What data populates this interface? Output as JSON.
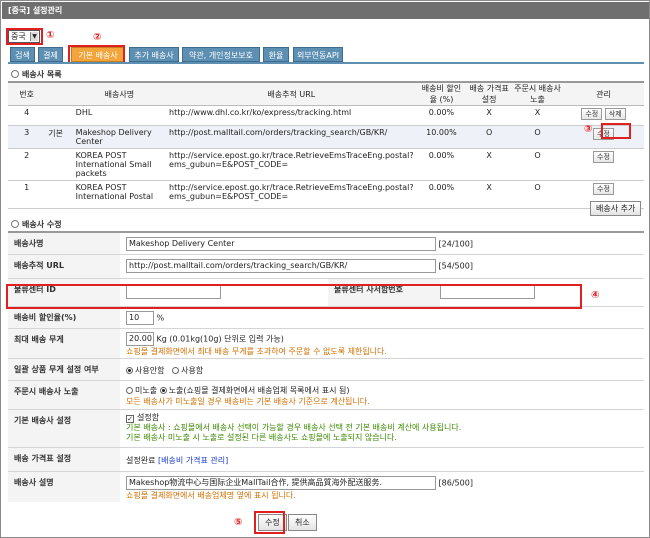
{
  "title": "[중국] 설정관리",
  "country_select": {
    "value": "중국"
  },
  "markers": [
    "①",
    "②",
    "③",
    "④",
    "⑤"
  ],
  "tabs": [
    "검색",
    "결제",
    "기본 배송사",
    "추가 배송사",
    "약관, 개인정보보호",
    "환율",
    "외부연동API"
  ],
  "list_section_title": "배송사 목록",
  "list": {
    "headers": [
      "번호",
      "",
      "배송사명",
      "배송추적 URL",
      "배송비 할인율 (%)",
      "배송 가격표 설정",
      "주문시 배송사 노출",
      "관리"
    ],
    "rows": [
      {
        "no": "4",
        "default": "",
        "name": "DHL",
        "url": "http://www.dhl.co.kr/ko/express/tracking.html",
        "discount": "0.00%",
        "price": "X",
        "show": "X",
        "edit": "수정",
        "delete": "삭제"
      },
      {
        "no": "3",
        "default": "기본",
        "name": "Makeshop Delivery Center",
        "url": "http://post.malltail.com/orders/tracking_search/GB/KR/",
        "discount": "10.00%",
        "price": "O",
        "show": "O",
        "edit": "수정",
        "delete": ""
      },
      {
        "no": "2",
        "default": "",
        "name": "KOREA POST International Small packets",
        "url": "http://service.epost.go.kr/trace.RetrieveEmsTraceEng.postal?ems_gubun=E&POST_CODE=",
        "discount": "0.00%",
        "price": "X",
        "show": "O",
        "edit": "수정",
        "delete": ""
      },
      {
        "no": "1",
        "default": "",
        "name": "KOREA POST International Postal",
        "url": "http://service.epost.go.kr/trace.RetrieveEmsTraceEng.postal?ems_gubun=E&POST_CODE=",
        "discount": "0.00%",
        "price": "X",
        "show": "O",
        "edit": "수정",
        "delete": ""
      }
    ]
  },
  "add_button": "배송사 추가",
  "edit_section_title": "배송사 수정",
  "form": {
    "name_label": "배송사명",
    "name_value": "Makeshop Delivery Center",
    "name_count": "[24/100]",
    "url_label": "배송추적 URL",
    "url_value": "http://post.malltail.com/orders/tracking_search/GB/KR/",
    "url_count": "[54/500]",
    "center_id_label": "물류센터 ID",
    "center_id_value": "",
    "center_biz_label": "물류센터 사서함번호",
    "center_biz_value": "",
    "discount_label": "배송비 할인율(%)",
    "discount_value": "10",
    "discount_unit": "%",
    "weight_label": "최대 배송 무게",
    "weight_value": "20.00",
    "weight_unit": "Kg (0.01kg(10g) 단위로 입력 가능)",
    "weight_hint": "쇼핑몰 결제화면에서 최대 배송 무게를 초과하여 주문할 수 없도록 제한됩니다.",
    "bulk_label": "일괄 상품 무게 설정 여부",
    "bulk_opt1": "사용안함",
    "bulk_opt2": "사용함",
    "expose_label": "주문시 배송사 노출",
    "expose_opt1": "미노출",
    "expose_opt2": "노출(쇼핑몰 결제화면에서 배송업체 목록에서 표시 됨)",
    "expose_hint": "모든 배송사가 미노출일 경우 배송비는 기본 배송사 기준으로 계산됩니다.",
    "default_label": "기본 배송사 설정",
    "default_check": "설정함",
    "default_hint1": "기본 배송사 : 쇼핑몰에서 배송사 선택이 가능할 경우 배송사 선택 전 기본 배송비 계산에 사용됩니다.",
    "default_hint2": "기본 배송사 미노출 시 노출로 설정된 다른 배송사도 쇼핑몰에 노출되지 않습니다.",
    "price_label": "배송 가격표 설정",
    "price_status": "설정완료",
    "price_link": "[배송비 가격표 관리]",
    "desc_label": "배송사 설명",
    "desc_value": "Makeshop物流中心与国际企业MallTail合作, 提供高品質海外配送服务.",
    "desc_count": "[86/500]",
    "desc_hint": "쇼핑몰 결제화면에서 배송업체명 옆에 표시 됩니다."
  },
  "buttons": {
    "save": "수정",
    "cancel": "취소"
  },
  "colors": {
    "accent_red": "#e02020",
    "tab_blue": "#5d8fb3",
    "tab_active": "#f3a43b"
  }
}
